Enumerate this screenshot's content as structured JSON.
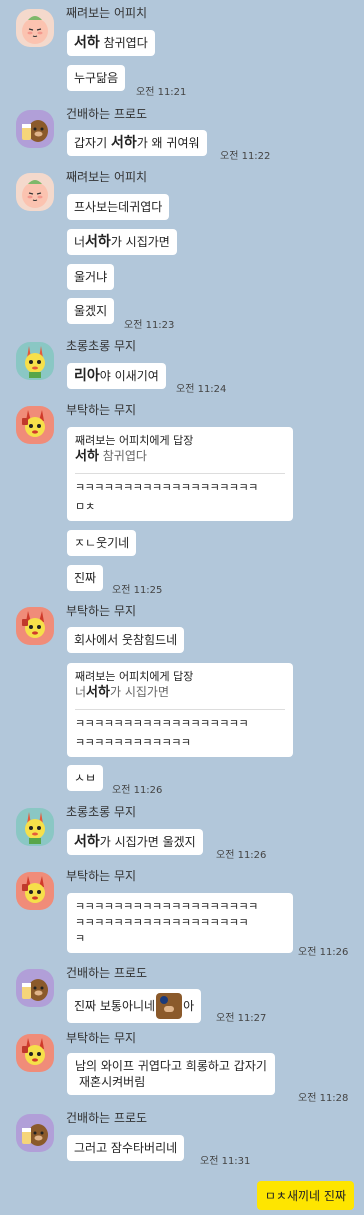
{
  "senders": {
    "apeach": "째려보는 어피치",
    "frodo": "건배하는 프로도",
    "muzi_green": "초롱초롱 무지",
    "muzi_red": "부탁하는 무지"
  },
  "g1": {
    "b1_name": "서하",
    "b1_rest": " 참귀엽다",
    "b2": "누구닮음",
    "time": "오전 11:21"
  },
  "g2": {
    "b1_pre": "갑자기 ",
    "b1_name": "서하",
    "b1_rest": "가 왜 귀여워",
    "time": "오전 11:22"
  },
  "g3": {
    "b1": "프사보는데귀엽다",
    "b2_pre": "너",
    "b2_name": "서하",
    "b2_rest": "가 시집가면",
    "b3": "울거냐",
    "b4": "울겠지",
    "time": "오전 11:23"
  },
  "g4": {
    "b1_name": "리아",
    "b1_rest": "야 이새기여",
    "time": "오전 11:24"
  },
  "g5": {
    "reply_head": "째려보는 어피치에게 답장",
    "reply_name": "서하",
    "reply_rest": " 참귀엽다",
    "reply_text_1": "ㅋㅋㅋㅋㅋㅋㅋㅋㅋㅋㅋㅋㅋㅋㅋㅋㅋㅋㅋ",
    "reply_text_2": "ㅁㅊ",
    "b2": "ㅈㄴ웃기네",
    "b3": "진짜",
    "time": "오전 11:25"
  },
  "g6": {
    "b1": "회사에서 웃참힘드네",
    "reply_head": "째려보는 어피치에게 답장",
    "reply_pre": "너",
    "reply_name": "서하",
    "reply_rest": "가 시집가면",
    "reply_text_1": "ㅋㅋㅋㅋㅋㅋㅋㅋㅋㅋㅋㅋㅋㅋㅋㅋㅋㅋ",
    "reply_text_2": "ㅋㅋㅋㅋㅋㅋㅋㅋㅋㅋㅋㅋ",
    "b3": "ㅅㅂ",
    "time": "오전 11:26"
  },
  "g7": {
    "b1_name": "서하",
    "b1_rest": "가 시집가면 울겠지",
    "time": "오전 11:26"
  },
  "g8": {
    "line1": "ㅋㅋㅋㅋㅋㅋㅋㅋㅋㅋㅋㅋㅋㅋㅋㅋㅋㅋㅋ",
    "line2": "ㅋㅋㅋㅋㅋㅋㅋㅋㅋㅋㅋㅋㅋㅋㅋㅋㅋㅋ",
    "line3": "ㅋ",
    "time": "오전 11:26"
  },
  "g9": {
    "b1_pre": "진짜 보통아니네",
    "b1_post": "아",
    "time": "오전 11:27"
  },
  "g10": {
    "line1": "남의 와이프 귀엽다고 희롱하고 갑자기",
    "line2": "재혼시켜버림",
    "time": "오전 11:28"
  },
  "g11": {
    "b1": "그러고 잠수타버리네",
    "time": "오전 11:31"
  },
  "mine": {
    "text": "ㅁㅊ새끼네 진짜"
  },
  "colors": {
    "background": "#b2c7da",
    "my_bubble": "#fee500",
    "other_bubble": "#ffffff"
  }
}
